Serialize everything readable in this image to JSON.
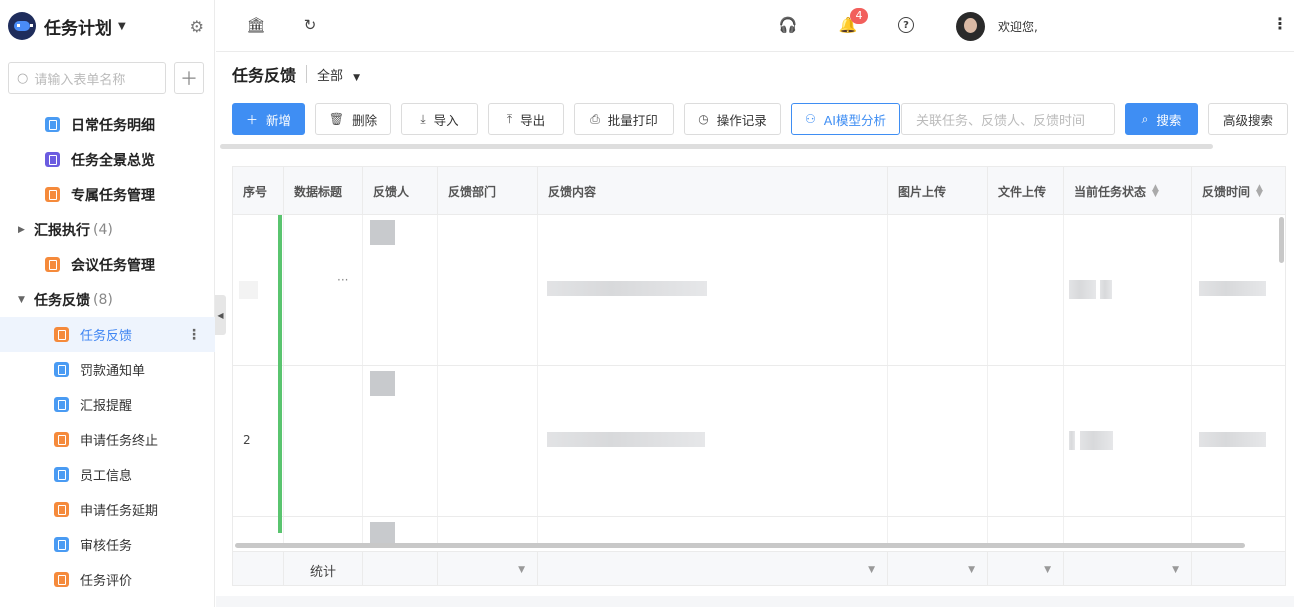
{
  "sidebar": {
    "app_title": "任务计划",
    "search_placeholder": "请输入表单名称",
    "items": [
      {
        "label": "日常任务明细",
        "icon": "form-icon-blue"
      },
      {
        "label": "任务全景总览",
        "icon": "form-icon-purple"
      },
      {
        "label": "专属任务管理",
        "icon": "form-icon-orange"
      },
      {
        "label": "汇报执行",
        "count": "(4)",
        "type": "group",
        "expanded": false
      },
      {
        "label": "会议任务管理",
        "icon": "form-icon-orange"
      },
      {
        "label": "任务反馈",
        "count": "(8)",
        "type": "group",
        "expanded": true
      },
      {
        "label": "任务反馈",
        "icon": "form-icon-orange",
        "active": true
      },
      {
        "label": "罚款通知单",
        "icon": "form-icon-blue"
      },
      {
        "label": "汇报提醒",
        "icon": "form-icon-blue"
      },
      {
        "label": "申请任务终止",
        "icon": "form-icon-orange"
      },
      {
        "label": "员工信息",
        "icon": "form-icon-blue"
      },
      {
        "label": "申请任务延期",
        "icon": "form-icon-orange"
      },
      {
        "label": "审核任务",
        "icon": "form-icon-blue"
      },
      {
        "label": "任务评价",
        "icon": "form-icon-orange"
      }
    ]
  },
  "topbar": {
    "notification_count": "4",
    "welcome_text": "欢迎您,"
  },
  "page": {
    "title": "任务反馈",
    "filter_label": "全部"
  },
  "toolbar": {
    "add": "新增",
    "delete": "删除",
    "import": "导入",
    "export": "导出",
    "batch_print": "批量打印",
    "history": "操作记录",
    "ai": "AI模型分析",
    "search_placeholder": "关联任务、反馈人、反馈时间",
    "search": "搜索",
    "advanced_search": "高级搜索"
  },
  "table": {
    "columns": [
      "序号",
      "数据标题",
      "反馈人",
      "反馈部门",
      "反馈内容",
      "图片上传",
      "文件上传",
      "当前任务状态",
      "反馈时间"
    ],
    "rows": [
      {
        "index": "",
        "title": "···"
      },
      {
        "index": "2",
        "title": ""
      },
      {
        "index": "",
        "title": ""
      }
    ],
    "footer_label": "统计"
  },
  "colors": {
    "primary": "#3f8ef3",
    "badge": "#f25f5c",
    "row_marker": "#5ac46f"
  }
}
